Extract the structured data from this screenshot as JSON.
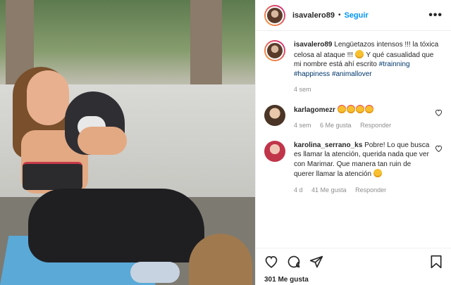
{
  "post": {
    "username": "isavalero89",
    "follow_label": "Seguir",
    "more_label": "•••",
    "separator": "•",
    "likes": "301 Me gusta"
  },
  "caption": {
    "username": "isavalero89",
    "text_before": "Lengüetazos intensos !!! la tóxica celosa al ataque !!!",
    "text_after": "Y qué casualidad que mi nombre está ahí escrito",
    "tags": [
      "#trainning",
      "#happiness",
      "#animallover"
    ],
    "time": "4 sem"
  },
  "comments": [
    {
      "username": "karlagomezr",
      "text": "",
      "emoji_count": 4,
      "time": "4 sem",
      "likes": "6 Me gusta",
      "reply": "Responder"
    },
    {
      "username": "karolina_serrano_ks",
      "text": "Pobre! Lo que busca es llamar la atención, querida nada que ver con Marimar. Que manera tan ruin de querer llamar la atención",
      "time": "4 d",
      "likes": "41 Me gusta",
      "reply": "Responder"
    }
  ],
  "icons": {
    "like": "heart-icon",
    "comment": "comment-icon",
    "share": "share-icon",
    "save": "bookmark-icon",
    "comment_like": "heart-outline-icon"
  },
  "colors": {
    "follow": "#0095f6",
    "hashtag": "#00376b",
    "meta": "#8e8e8e"
  }
}
